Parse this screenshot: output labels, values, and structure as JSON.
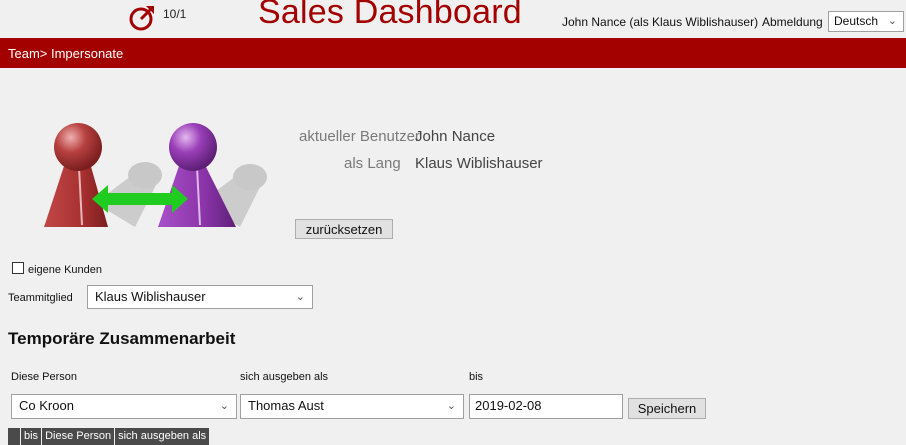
{
  "header": {
    "version": "10/1",
    "title": "Sales Dashboard",
    "user": "John Nance (als Klaus Wiblishauser)",
    "logout": "Abmeldung",
    "language": "Deutsch"
  },
  "breadcrumb": "Team> Impersonate",
  "impersonation": {
    "current_user_label": "aktueller Benutzer",
    "current_user_value": "John Nance",
    "as_label": "als Lang",
    "as_value": "Klaus Wiblishauser",
    "reset_button": "zurücksetzen"
  },
  "filters": {
    "own_customers_label": "eigene Kunden",
    "own_customers_checked": false,
    "team_member_label": "Teammitglied",
    "team_member_value": "Klaus Wiblishauser"
  },
  "temporary": {
    "title": "Temporäre Zusammenarbeit",
    "col_person": "Diese Person",
    "col_as": "sich ausgeben als",
    "col_until": "bis",
    "person_value": "Co Kroon",
    "as_value": "Thomas Aust",
    "until_value": "2019-02-08",
    "save_button": "Speichern"
  },
  "table": {
    "headers": [
      "",
      "bis",
      "Diese Person",
      "sich ausgeben als"
    ]
  },
  "colors": {
    "brand": "#a30000",
    "navbar": "#a30000",
    "avatar_left": "#b03a3a",
    "avatar_right": "#9a3fb8",
    "arrow": "#1fcc1f"
  },
  "icons": {
    "logo": "gauge-arrow-icon",
    "dropdown": "chevron-down-icon"
  }
}
